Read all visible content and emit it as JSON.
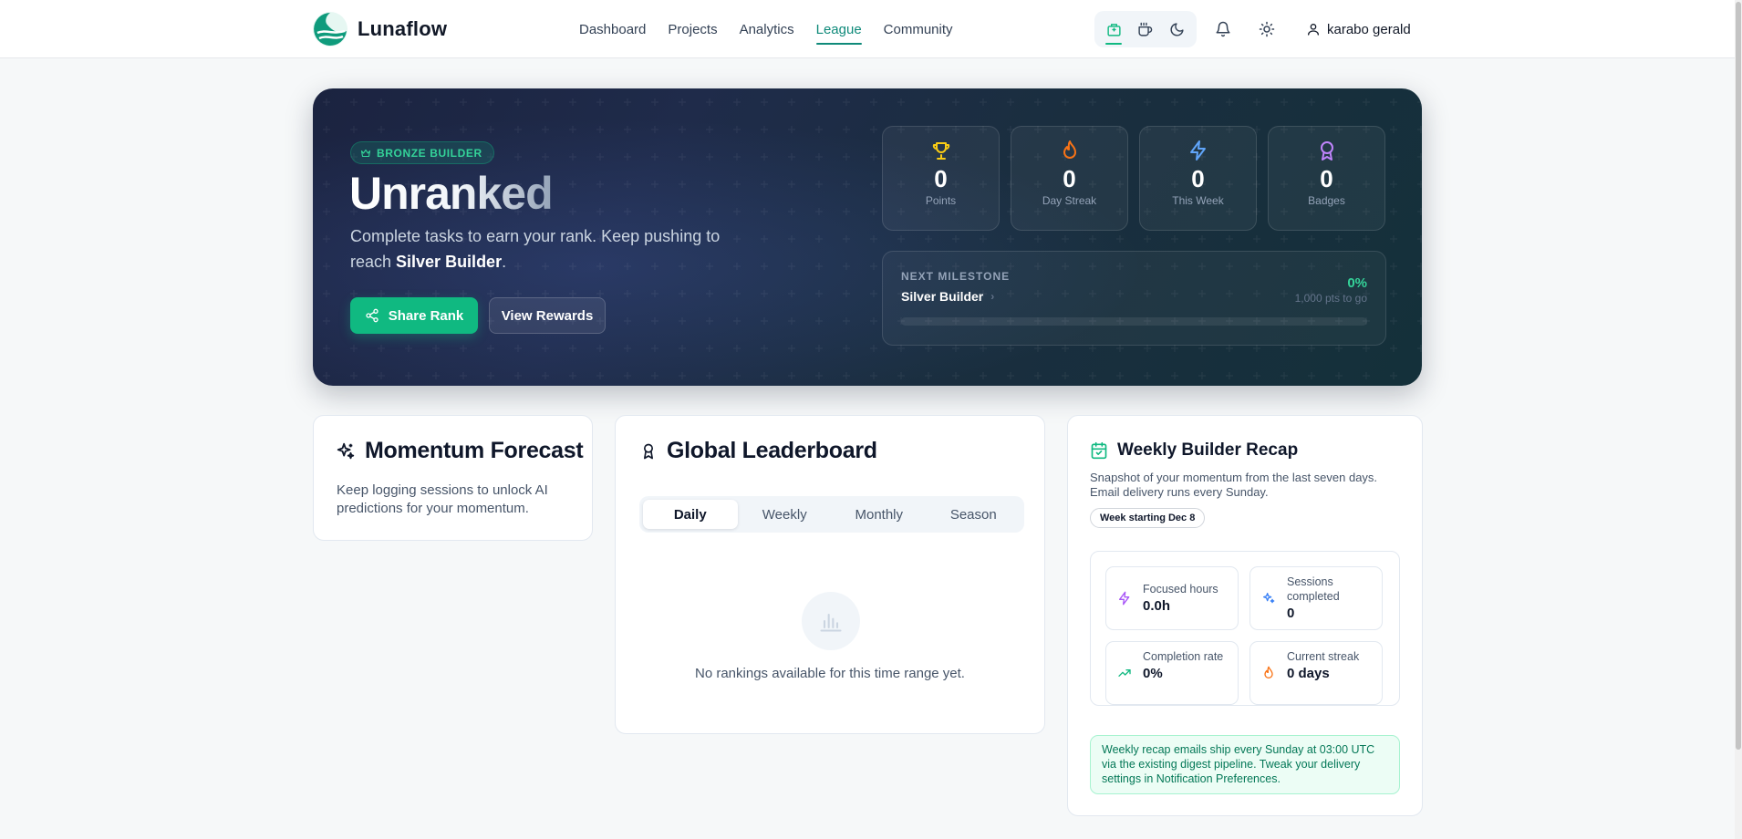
{
  "app": {
    "name": "Lunaflow"
  },
  "nav": {
    "items": [
      "Dashboard",
      "Projects",
      "Analytics",
      "League",
      "Community"
    ],
    "active": "League"
  },
  "user": {
    "name": "karabo gerald"
  },
  "hero": {
    "badge": "BRONZE BUILDER",
    "rank": "Unranked",
    "subtitle_before": "Complete tasks to earn your rank. Keep pushing to reach ",
    "subtitle_target": "Silver Builder",
    "subtitle_after": ".",
    "share_label": "Share Rank",
    "rewards_label": "View Rewards",
    "stats": [
      {
        "value": "0",
        "label": "Points",
        "icon": "trophy-icon",
        "color": "#facc15"
      },
      {
        "value": "0",
        "label": "Day Streak",
        "icon": "flame-icon",
        "color": "#f97316"
      },
      {
        "value": "0",
        "label": "This Week",
        "icon": "lightning-icon",
        "color": "#60a5fa"
      },
      {
        "value": "0",
        "label": "Badges",
        "icon": "award-icon",
        "color": "#c084fc"
      }
    ],
    "milestone": {
      "kicker": "NEXT MILESTONE",
      "name": "Silver Builder",
      "percent": "0%",
      "progress": 0,
      "to_go": "1,000 pts to go"
    }
  },
  "forecast": {
    "title": "Momentum Forecast",
    "text": "Keep logging sessions to unlock AI predictions for your momentum."
  },
  "leaderboard": {
    "title": "Global Leaderboard",
    "tabs": [
      "Daily",
      "Weekly",
      "Monthly",
      "Season"
    ],
    "active_tab": "Daily",
    "empty_text": "No rankings available for this time range yet."
  },
  "recap": {
    "title": "Weekly Builder Recap",
    "subtitle": "Snapshot of your momentum from the last seven days. Email delivery runs every Sunday.",
    "week": "Week starting Dec 8",
    "metrics": [
      {
        "label": "Focused hours",
        "value": "0.0h",
        "icon": "lightning-icon"
      },
      {
        "label": "Sessions completed",
        "value": "0",
        "icon": "sparkle-icon"
      },
      {
        "label": "Completion rate",
        "value": "0%",
        "icon": "trend-up-icon"
      },
      {
        "label": "Current streak",
        "value": "0 days",
        "icon": "flame-icon"
      }
    ],
    "note": "Weekly recap emails ship every Sunday at 03:00 UTC via the existing digest pipeline. Tweak your delivery settings in Notification Preferences."
  },
  "colors": {
    "accent": "#10b981",
    "hero_bg": "#1b2340",
    "nav_active": "#0f8a7a"
  }
}
